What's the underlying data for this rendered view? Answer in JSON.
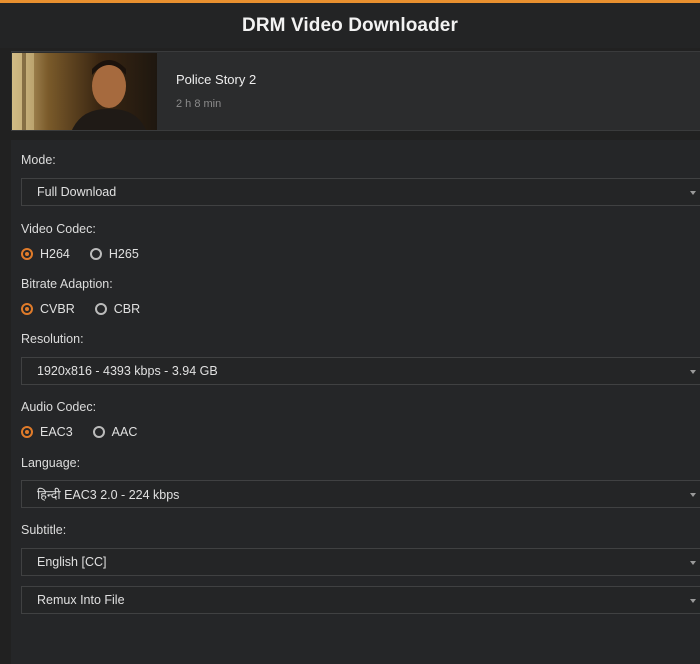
{
  "app": {
    "title": "DRM Video Downloader"
  },
  "media": {
    "title": "Police Story 2",
    "duration": "2 h 8 min"
  },
  "form": {
    "mode": {
      "label": "Mode:",
      "value": "Full Download"
    },
    "video_codec": {
      "label": "Video Codec:",
      "options": [
        "H264",
        "H265"
      ],
      "selected": "H264"
    },
    "bitrate": {
      "label": "Bitrate Adaption:",
      "options": [
        "CVBR",
        "CBR"
      ],
      "selected": "CVBR"
    },
    "resolution": {
      "label": "Resolution:",
      "value": "1920x816 - 4393 kbps - 3.94 GB"
    },
    "audio_codec": {
      "label": "Audio Codec:",
      "options": [
        "EAC3",
        "AAC"
      ],
      "selected": "EAC3"
    },
    "language": {
      "label": "Language:",
      "value": "हिन्दी EAC3 2.0 - 224 kbps"
    },
    "subtitle": {
      "label": "Subtitle:",
      "value": "English [CC]"
    },
    "output": {
      "value": "Remux Into File"
    }
  },
  "colors": {
    "accent": "#e07b2a",
    "top_bar": "#e8902f",
    "background": "#212121"
  }
}
